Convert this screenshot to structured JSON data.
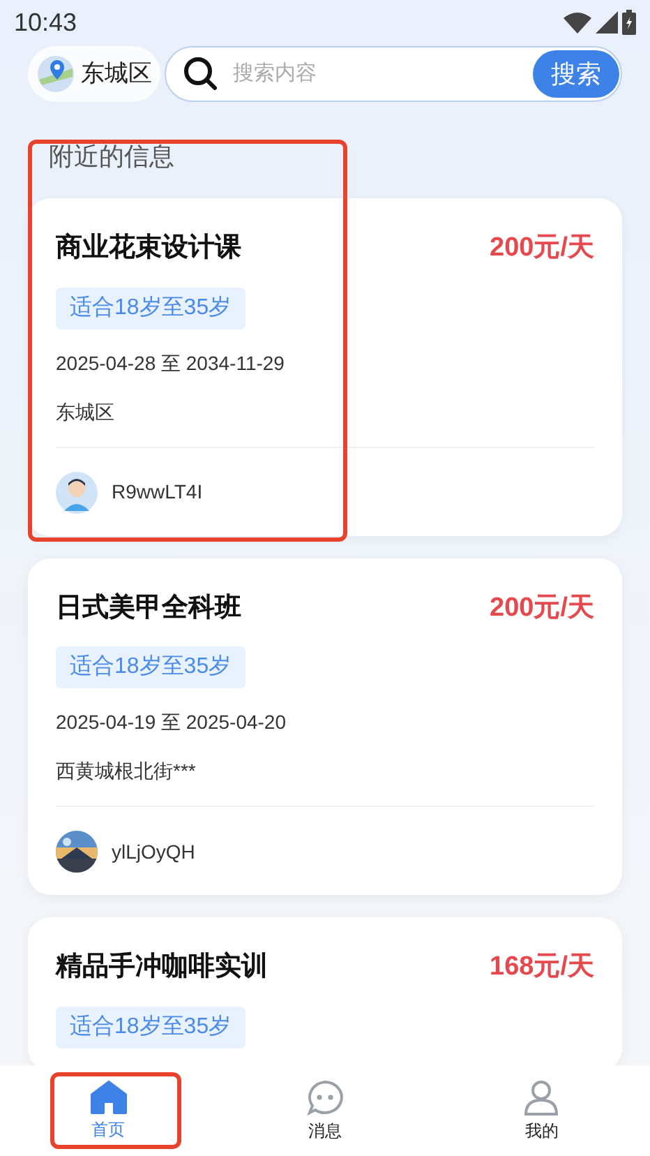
{
  "status_bar": {
    "time": "10:43"
  },
  "header": {
    "location": "东城区",
    "search": {
      "placeholder": "搜索内容"
    },
    "search_button": "搜索"
  },
  "section_title": "附近的信息",
  "section_highlighted": true,
  "listings": [
    {
      "title": "商业花束设计课",
      "price": "200元/天",
      "tag": "适合18岁至35岁",
      "dates": "2025-04-28 至 2034-11-29",
      "location": "东城区",
      "user": {
        "name": "R9wwLT4I",
        "kind": "figure"
      }
    },
    {
      "title": "日式美甲全科班",
      "price": "200元/天",
      "tag": "适合18岁至35岁",
      "dates": "2025-04-19 至 2025-04-20",
      "location": "西黄城根北街***",
      "user": {
        "name": "ylLjOyQH",
        "kind": "picture"
      }
    },
    {
      "title": "精品手冲咖啡实训",
      "price": "168元/天",
      "tag": "适合18岁至35岁"
    }
  ],
  "tab_bar": [
    {
      "label": "首页",
      "kind": "home",
      "selected": true,
      "highlighted": true
    },
    {
      "label": "消息",
      "kind": "chat",
      "selected": false,
      "highlighted": false
    },
    {
      "label": "我的",
      "kind": "person",
      "selected": false,
      "highlighted": false
    }
  ]
}
